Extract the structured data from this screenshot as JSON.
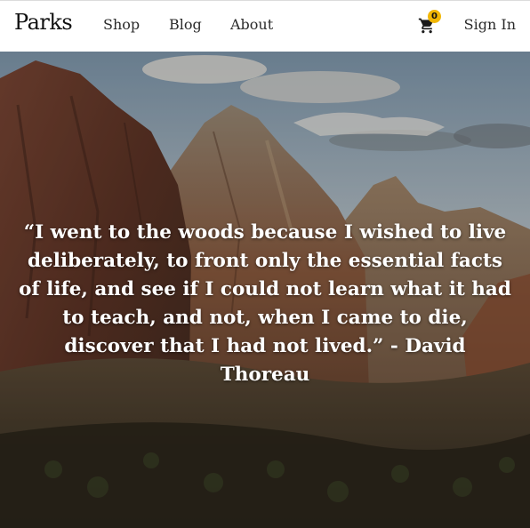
{
  "header": {
    "brand": "Parks",
    "nav": [
      {
        "label": "Shop"
      },
      {
        "label": "Blog"
      },
      {
        "label": "About"
      }
    ],
    "cart": {
      "icon": "cart-icon",
      "count": "0",
      "badge_color": "#f2b705"
    },
    "signin_label": "Sign In"
  },
  "hero": {
    "background": "mountain-canyon-photo",
    "quote": "“I went to the woods because I wished to live deliberately, to front only the essential facts of life, and see if I could not learn what it had to teach, and not, when I came to die, discover that I had not lived.” - David Thoreau"
  }
}
